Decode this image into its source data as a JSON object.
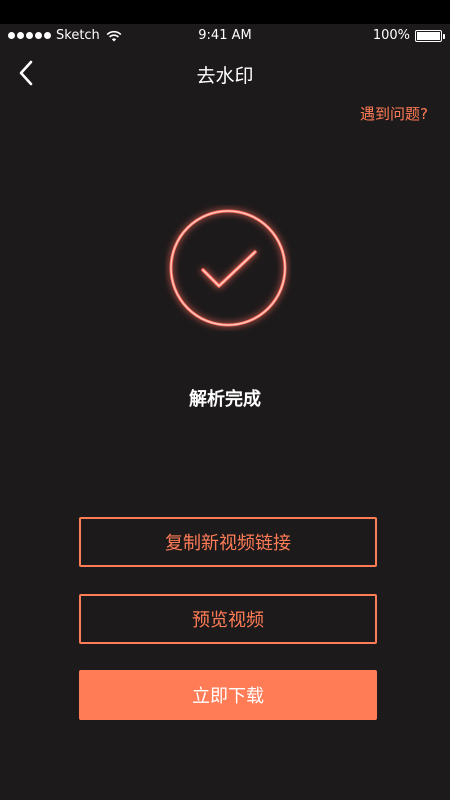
{
  "status_bar": {
    "carrier": "Sketch",
    "time": "9:41 AM",
    "battery": "100%"
  },
  "nav": {
    "title": "去水印",
    "back_icon": "chevron-left-icon"
  },
  "help_link": "遇到问题?",
  "result": {
    "icon": "check-circle-icon",
    "status": "解析完成"
  },
  "buttons": {
    "copy_link": "复制新视频链接",
    "preview": "预览视频",
    "download": "立即下载"
  },
  "colors": {
    "background": "#1d1a1b",
    "accent": "#ff7c56"
  }
}
